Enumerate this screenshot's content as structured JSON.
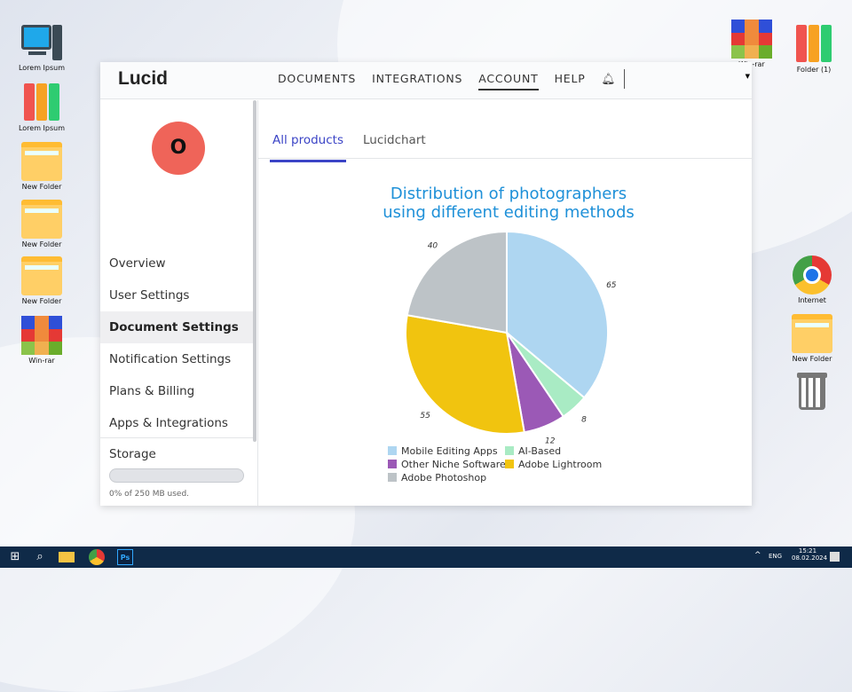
{
  "desktop": {
    "left": [
      "Lorem Ipsum",
      "Lorem Ipsum",
      "New Folder",
      "New Folder",
      "New Folder",
      "Win-rar"
    ],
    "right": [
      "Win-rar",
      "Folder (1)",
      "Internet",
      "New Folder"
    ]
  },
  "app": {
    "logo": "Lucid",
    "nav": [
      "DOCUMENTS",
      "INTEGRATIONS",
      "ACCOUNT",
      "HELP"
    ],
    "avatar_initial": "O",
    "menu": [
      "Overview",
      "User Settings",
      "Document Settings",
      "Notification Settings",
      "Plans & Billing",
      "Apps & Integrations"
    ],
    "storage": {
      "label": "Storage",
      "text": "0% of 250 MB used.",
      "used_fraction": 0
    },
    "tabs": [
      "All products",
      "Lucidchart"
    ]
  },
  "chart_data": {
    "type": "pie",
    "title": "Distribution of photographers using different editing methods",
    "categories": [
      "Mobile Editing Apps",
      "AI-Based",
      "Other Niche Software",
      "Adobe Lightroom",
      "Adobe Photoshop"
    ],
    "values": [
      65,
      8,
      12,
      55,
      40
    ],
    "colors": [
      "#aed6f1",
      "#a9ebc4",
      "#9b59b6",
      "#f1c40f",
      "#bdc3c7"
    ],
    "legend_order": [
      0,
      1,
      2,
      3,
      4
    ],
    "legend_position": "bottom"
  },
  "taskbar": {
    "lang": "ENG",
    "time": "15:21",
    "date": "08.02.2024"
  }
}
